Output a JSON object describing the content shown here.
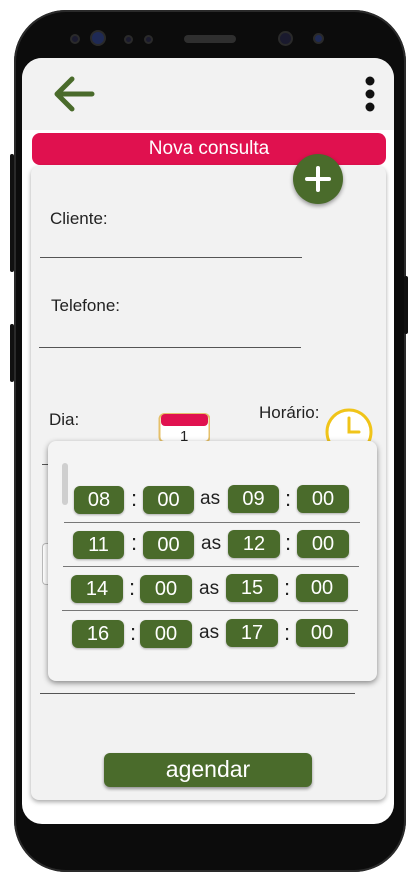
{
  "header": {
    "title": "Nova consulta"
  },
  "form": {
    "cliente_label": "Cliente:",
    "telefone_label": "Telefone:",
    "dia_label": "Dia:",
    "horario_label": "Horário:",
    "calendar_day": "1"
  },
  "time_slots": [
    {
      "start_h": "08",
      "start_m": "00",
      "sep": "as",
      "end_h": "09",
      "end_m": "00"
    },
    {
      "start_h": "11",
      "start_m": "00",
      "sep": "as",
      "end_h": "12",
      "end_m": "00"
    },
    {
      "start_h": "14",
      "start_m": "00",
      "sep": "as",
      "end_h": "15",
      "end_m": "00"
    },
    {
      "start_h": "16",
      "start_m": "00",
      "sep": "as",
      "end_h": "17",
      "end_m": "00"
    }
  ],
  "colon": ":",
  "actions": {
    "schedule_label": "agendar"
  },
  "icons": {
    "back": "arrow-left-icon",
    "menu": "more-vert-icon",
    "add": "plus-icon",
    "calendar": "calendar-icon",
    "clock": "clock-icon"
  },
  "colors": {
    "accent": "#e0114f",
    "primary": "#4a6b2b",
    "clock": "#f0c419"
  }
}
